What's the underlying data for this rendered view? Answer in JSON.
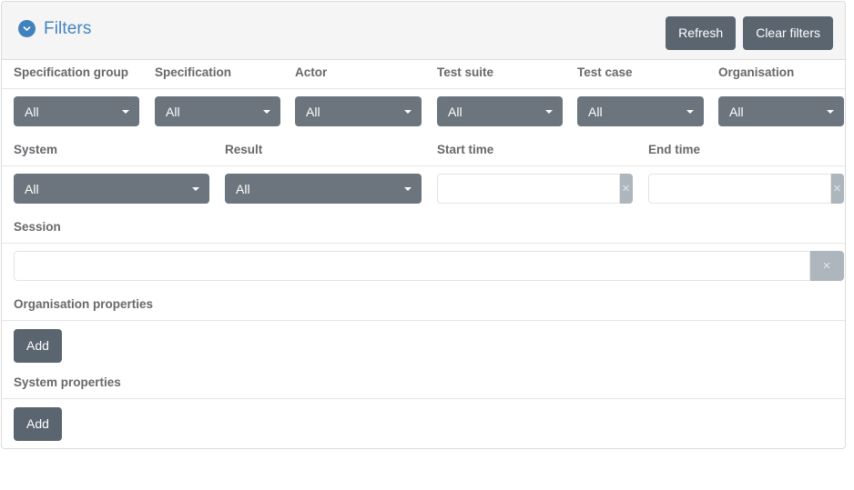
{
  "header": {
    "title": "Filters",
    "toggle_icon": "chevron-down-icon",
    "accent_color": "#3f82bd",
    "title_color": "#4584c0",
    "refresh_label": "Refresh",
    "clear_filters_label": "Clear filters"
  },
  "theme": {
    "dropdown_bg": "#6c757d",
    "button_bg": "#5b6570",
    "clear_button_bg": "#adb5bd",
    "label_color": "#66686b",
    "card_border": "#dcdcdc",
    "header_bg": "#f5f5f5"
  },
  "row1": {
    "labels": [
      "Specification group",
      "Specification",
      "Actor",
      "Test suite",
      "Test case",
      "Organisation"
    ],
    "dropdowns": [
      {
        "name": "specification-group",
        "value": "All"
      },
      {
        "name": "specification",
        "value": "All"
      },
      {
        "name": "actor",
        "value": "All"
      },
      {
        "name": "test-suite",
        "value": "All"
      },
      {
        "name": "test-case",
        "value": "All"
      },
      {
        "name": "organisation",
        "value": "All"
      }
    ]
  },
  "row2": {
    "labels": [
      "System",
      "Result",
      "Start time",
      "End time"
    ],
    "system": {
      "value": "All"
    },
    "result": {
      "value": "All"
    },
    "start_time": {
      "value": "",
      "placeholder": "",
      "clear_label": "×"
    },
    "end_time": {
      "value": "",
      "placeholder": "",
      "clear_label": "×"
    }
  },
  "row3": {
    "label": "Session",
    "session": {
      "value": "",
      "placeholder": "",
      "clear_label": "×"
    }
  },
  "row4": {
    "label": "Organisation properties",
    "add_label": "Add"
  },
  "row5": {
    "label": "System properties",
    "add_label": "Add"
  }
}
